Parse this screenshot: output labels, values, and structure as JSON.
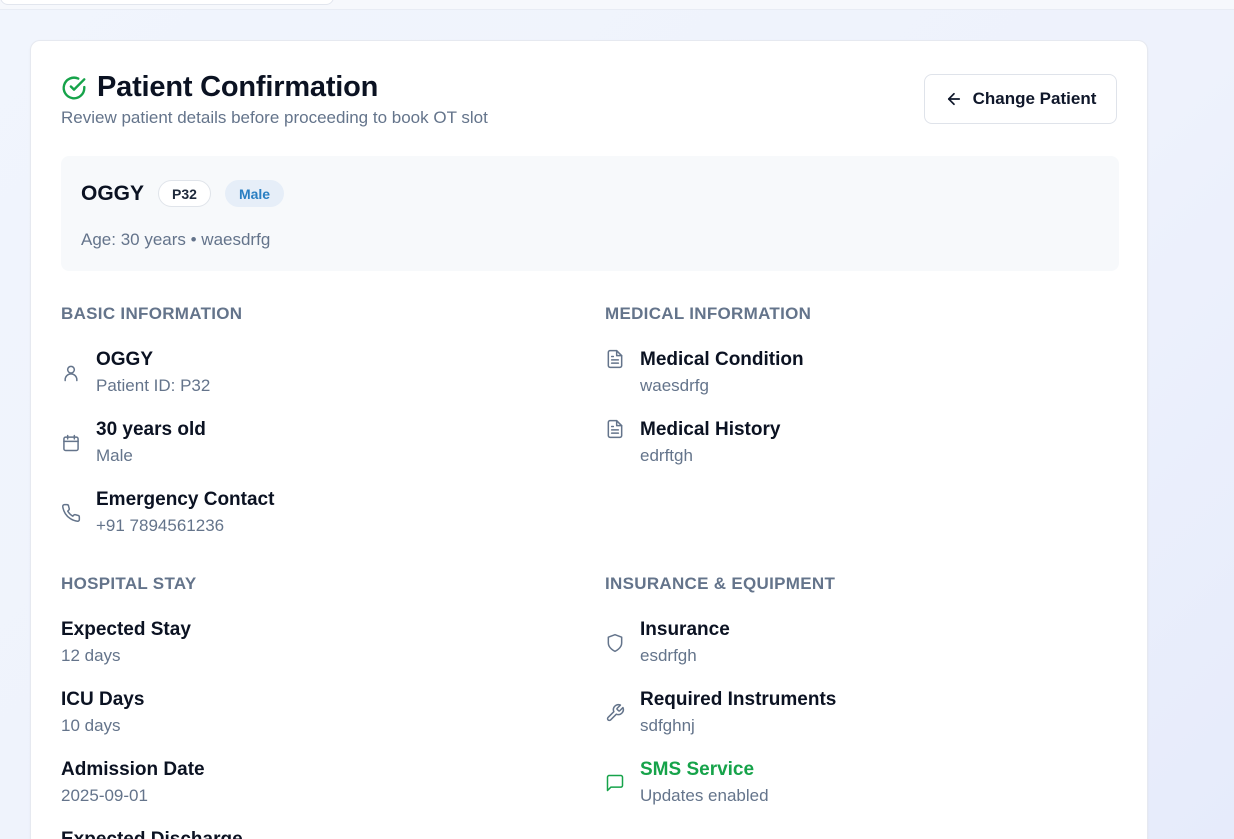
{
  "header": {
    "title": "Patient Confirmation",
    "subtitle": "Review patient details before proceeding to book OT slot",
    "change_patient_label": "Change Patient"
  },
  "summary": {
    "name": "OGGY",
    "patient_id": "P32",
    "gender": "Male",
    "meta": "Age: 30 years • waesdrfg"
  },
  "basic_information": {
    "title": "BASIC INFORMATION",
    "items": [
      {
        "icon": "user-icon",
        "label": "OGGY",
        "value": "Patient ID: P32"
      },
      {
        "icon": "calendar-icon",
        "label": "30 years old",
        "value": "Male"
      },
      {
        "icon": "phone-icon",
        "label": "Emergency Contact",
        "value": "+91 7894561236"
      }
    ]
  },
  "medical_information": {
    "title": "MEDICAL INFORMATION",
    "items": [
      {
        "icon": "document-icon",
        "label": "Medical Condition",
        "value": "waesdrfg"
      },
      {
        "icon": "document-icon",
        "label": "Medical History",
        "value": "edrftgh"
      }
    ]
  },
  "hospital_stay": {
    "title": "HOSPITAL STAY",
    "items": [
      {
        "label": "Expected Stay",
        "value": "12 days"
      },
      {
        "label": "ICU Days",
        "value": "10 days"
      },
      {
        "label": "Admission Date",
        "value": "2025-09-01"
      },
      {
        "label": "Expected Discharge",
        "value": ""
      }
    ]
  },
  "insurance_equipment": {
    "title": "INSURANCE & EQUIPMENT",
    "items": [
      {
        "icon": "shield-icon",
        "label": "Insurance",
        "value": "esdrfgh"
      },
      {
        "icon": "wrench-icon",
        "label": "Required Instruments",
        "value": "sdfghnj"
      },
      {
        "icon": "message-icon",
        "label": "SMS Service",
        "value": "Updates enabled"
      }
    ]
  },
  "colors": {
    "accent_green": "#16a34a",
    "badge_blue": "#2a7fc2",
    "muted_text": "#64748b"
  }
}
